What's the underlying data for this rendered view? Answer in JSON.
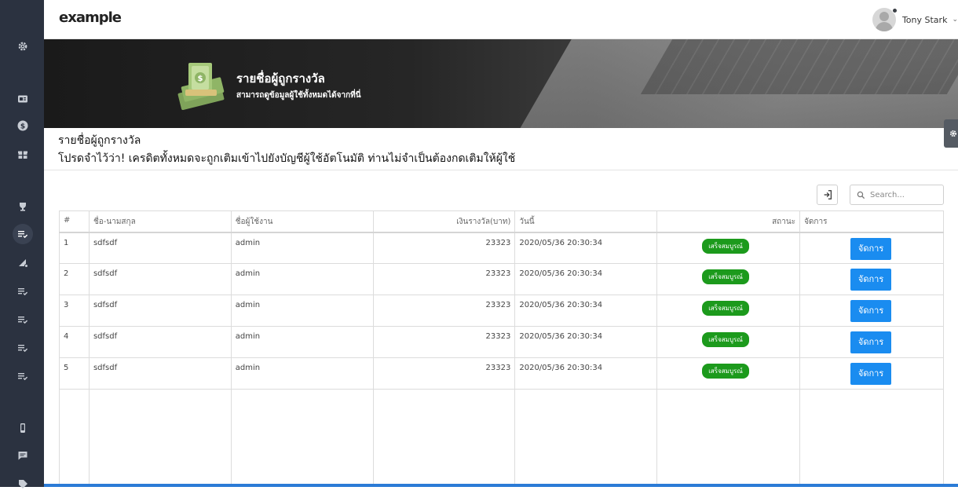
{
  "app": {
    "logo": "example"
  },
  "user": {
    "name": "Tony Stark"
  },
  "sidebar": {
    "icons": [
      "gear-icon",
      "id-card-icon",
      "dollar-icon",
      "gift-icon",
      "trophy-icon",
      "list-check-icon",
      "megaphone-icon",
      "list-check-icon",
      "list-check-icon",
      "list-check-icon",
      "list-check-icon",
      "phone-icon",
      "chat-icon"
    ]
  },
  "banner": {
    "title": "รายชื่อผู้ถูกรางวัล",
    "subtitle": "สามารถดูข้อมูลผู้ใช้ทั้งหมดได้จากที่นี่"
  },
  "page": {
    "heading": "รายชื่อผู้ถูกรางวัล",
    "notice": "โปรดจำไว้ว่า! เครดิตทั้งหมดจะถูกเติมเข้าไปยังบัญชีผู้ใช้อัตโนมัติ ท่านไม่จำเป็นต้องกดเติมให้ผู้ใช้"
  },
  "search": {
    "placeholder": "Search..."
  },
  "table": {
    "columns": [
      "#",
      "ชื่อ-นามสกุล",
      "ชื่อผู้ใช้งาน",
      "เงินรางวัล(บาท)",
      "วันนี้",
      "สถานะ",
      "จัดการ"
    ],
    "rows": [
      {
        "id": "1",
        "name": "sdfsdf",
        "username": "admin",
        "amount": "23323",
        "date": "2020/05/36 20:30:34",
        "status": "เสร็จสมบูรณ์",
        "action": "จัดการ"
      },
      {
        "id": "2",
        "name": "sdfsdf",
        "username": "admin",
        "amount": "23323",
        "date": "2020/05/36 20:30:34",
        "status": "เสร็จสมบูรณ์",
        "action": "จัดการ"
      },
      {
        "id": "3",
        "name": "sdfsdf",
        "username": "admin",
        "amount": "23323",
        "date": "2020/05/36 20:30:34",
        "status": "เสร็จสมบูรณ์",
        "action": "จัดการ"
      },
      {
        "id": "4",
        "name": "sdfsdf",
        "username": "admin",
        "amount": "23323",
        "date": "2020/05/36 20:30:34",
        "status": "เสร็จสมบูรณ์",
        "action": "จัดการ"
      },
      {
        "id": "5",
        "name": "sdfsdf",
        "username": "admin",
        "amount": "23323",
        "date": "2020/05/36 20:30:34",
        "status": "เสร็จสมบูรณ์",
        "action": "จัดการ"
      }
    ]
  },
  "colors": {
    "sidebar": "#2b3240",
    "accent": "#1a8cf0",
    "success": "#1c9a1c"
  }
}
